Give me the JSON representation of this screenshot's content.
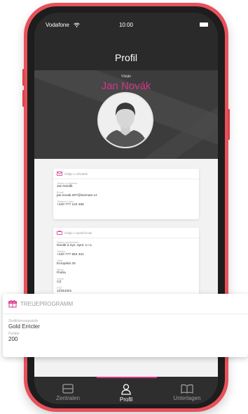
{
  "status_bar": {
    "carrier": "Vodafone",
    "time": "10:00"
  },
  "header": {
    "title": "Profil"
  },
  "hero": {
    "caption": "Vítejte",
    "name": "Jan Novák"
  },
  "cards": {
    "user": {
      "title": "Údaje o uživateli",
      "fields": [
        {
          "label": "Jméno a příjmení",
          "value": "Jan Novák"
        },
        {
          "label": "Email",
          "value": "jan.novak.007@seznam.cz"
        },
        {
          "label": "Telefonní číslo",
          "value": "+420 777 123 456"
        }
      ]
    },
    "company": {
      "title": "Údaje o společnosti",
      "fields": [
        {
          "label": "Název společnosti",
          "value": "Novák a syn, spol. s r.o."
        },
        {
          "label": "Telefon",
          "value": "+420 777 654 321"
        },
        {
          "label": "Ulice",
          "value": "Evropská 33"
        },
        {
          "label": "Město",
          "value": "Praha"
        },
        {
          "label": "Země",
          "value": "CZ"
        },
        {
          "label": "PSČ",
          "value": "12344321"
        }
      ]
    }
  },
  "loyalty": {
    "title": "TREUEPROGRAMM",
    "level_label": "Zertifizierungsstufe",
    "level_value": "Gold Erricter",
    "points_label": "Punkte",
    "points_value": "200"
  },
  "tabbar": {
    "tabs": [
      {
        "label": "Zentralen",
        "icon": "building-icon"
      },
      {
        "label": "Profil",
        "icon": "person-icon",
        "active": true
      },
      {
        "label": "Unterlagen",
        "icon": "book-icon"
      }
    ]
  },
  "colors": {
    "accent": "#d6338a",
    "phone_frame": "#e8505a"
  }
}
